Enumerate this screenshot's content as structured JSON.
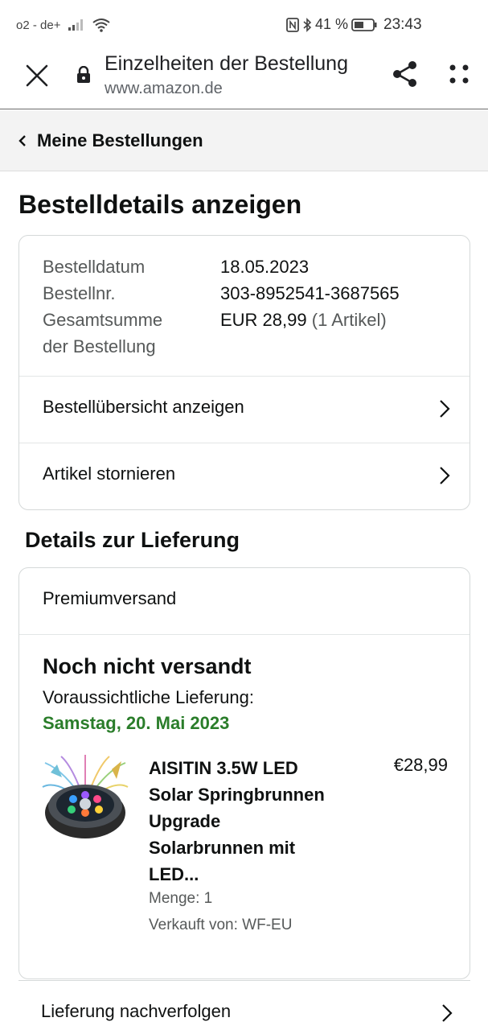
{
  "status_bar": {
    "carrier": "o2 - de+",
    "battery_percent": "41 %",
    "time": "23:43"
  },
  "browser": {
    "title": "Einzelheiten der Bestellung",
    "url": "www.amazon.de"
  },
  "breadcrumb": {
    "label": "Meine Bestellungen"
  },
  "page": {
    "heading": "Bestelldetails anzeigen"
  },
  "order_info": {
    "date_label": "Bestelldatum",
    "date_value": "18.05.2023",
    "number_label": "Bestellnr.",
    "number_value": "303-8952541-3687565",
    "total_label_line1": "Gesamtsumme",
    "total_label_line2": "der Bestellung",
    "total_value": "EUR 28,99",
    "total_items": "(1 Artikel)"
  },
  "order_actions": {
    "view_summary": "Bestellübersicht anzeigen",
    "cancel_items": "Artikel stornieren"
  },
  "delivery": {
    "heading": "Details zur Lieferung",
    "shipping_type": "Premiumversand",
    "status": "Noch nicht versandt",
    "expected_label": "Voraussichtliche Lieferung:",
    "expected_date": "Samstag, 20. Mai 2023",
    "expected_date_color": "#2a7d2a"
  },
  "product": {
    "title_line1": "AISITIN 3.5W LED",
    "title_line2": "Solar Springbrunnen",
    "title_line3": "Upgrade",
    "title_line4": "Solarbrunnen mit",
    "title_line5": "LED...",
    "price": "€28,99",
    "quantity": "Menge: 1",
    "seller": "Verkauft von: WF-EU"
  },
  "tracking": {
    "label": "Lieferung nachverfolgen"
  }
}
